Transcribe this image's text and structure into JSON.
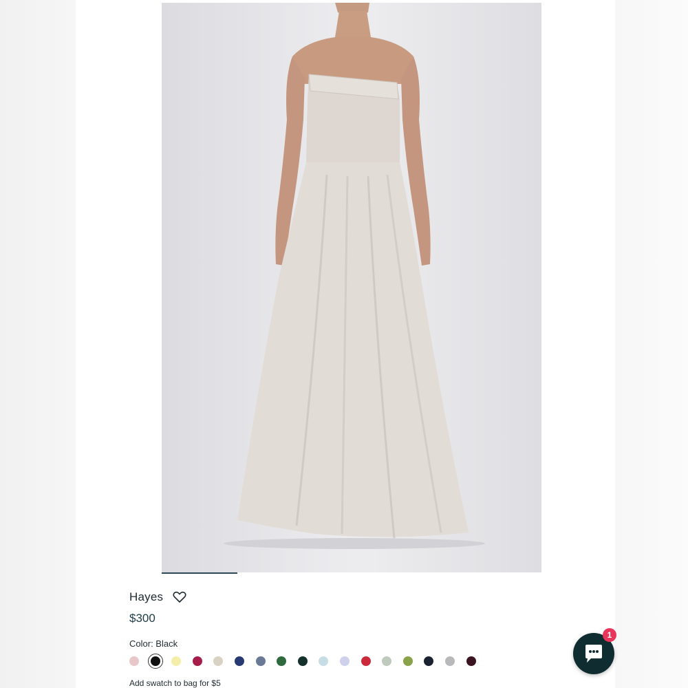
{
  "product": {
    "title": "Hayes",
    "price": "$300",
    "color_label": "Color: Black",
    "swatch_note": "Add swatch to bag for $5",
    "gallery_progress": 0.2
  },
  "swatches": [
    {
      "color": "#e8c7cb",
      "selected": false
    },
    {
      "color": "#111111",
      "selected": true
    },
    {
      "color": "#f3efaa",
      "selected": false
    },
    {
      "color": "#a61d4a",
      "selected": false
    },
    {
      "color": "#d8d2c2",
      "selected": false
    },
    {
      "color": "#273a73",
      "selected": false
    },
    {
      "color": "#6a7a96",
      "selected": false
    },
    {
      "color": "#2f6a3f",
      "selected": false
    },
    {
      "color": "#16302c",
      "selected": false
    },
    {
      "color": "#c7dde6",
      "selected": false
    },
    {
      "color": "#cfd1ec",
      "selected": false
    },
    {
      "color": "#cc2a3a",
      "selected": false
    },
    {
      "color": "#bfc9bd",
      "selected": false
    },
    {
      "color": "#8aa34a",
      "selected": false
    },
    {
      "color": "#1b2333",
      "selected": false
    },
    {
      "color": "#b8b9bb",
      "selected": false
    },
    {
      "color": "#3a1420",
      "selected": false
    }
  ],
  "chat": {
    "badge_count": "1",
    "icon": "chat-bubble-icon"
  },
  "icons": {
    "wishlist": "heart-icon"
  },
  "colors": {
    "accent": "#2b4a55",
    "chat_bg": "#0f2c30",
    "badge": "#e8355a"
  }
}
